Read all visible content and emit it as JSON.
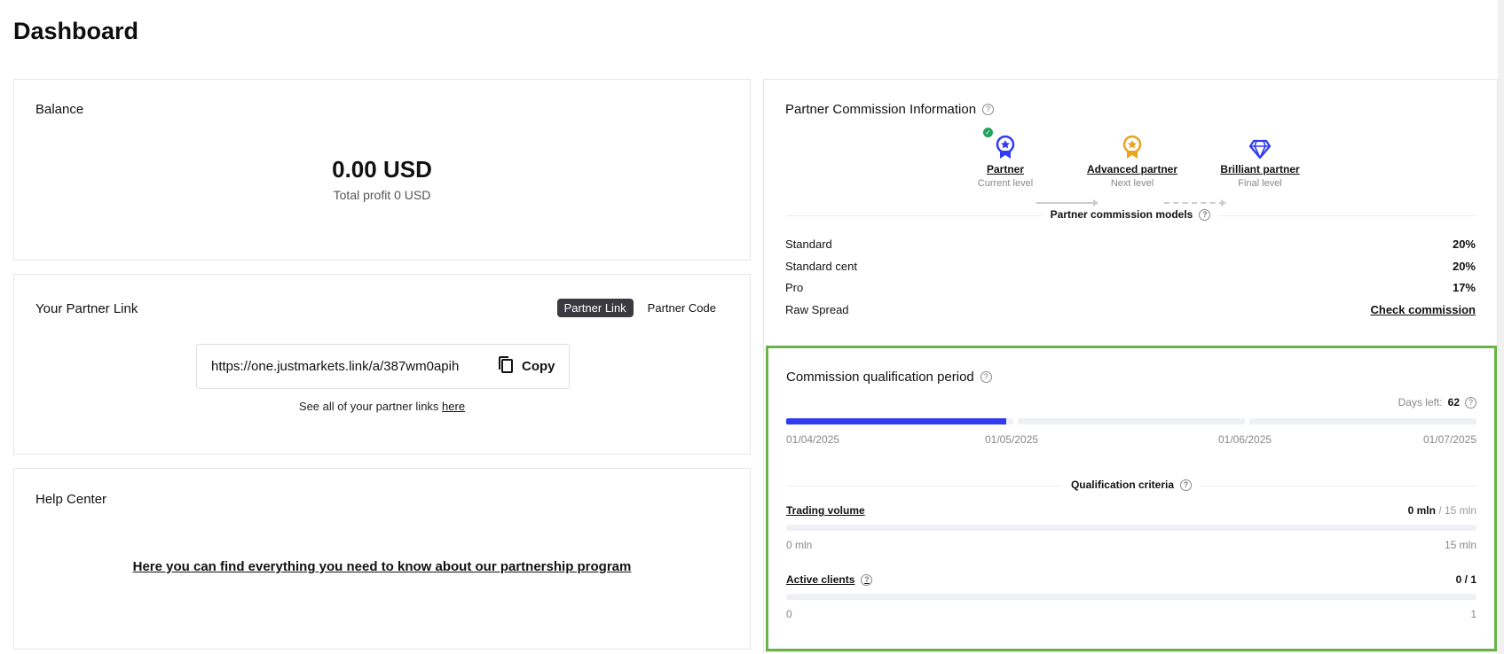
{
  "page": {
    "title": "Dashboard"
  },
  "balance": {
    "title": "Balance",
    "amount": "0.00 USD",
    "total_profit": "Total profit 0 USD"
  },
  "partner_link": {
    "title": "Your Partner Link",
    "toggles": [
      "Partner Link",
      "Partner Code"
    ],
    "active_toggle": "Partner Link",
    "url": "https://one.justmarkets.link/a/387wm0apih",
    "copy_label": "Copy",
    "note_prefix": "See all of your partner links ",
    "note_link": "here"
  },
  "help_center": {
    "title": "Help Center",
    "link_text": "Here you can find everything you need to know about our partnership program"
  },
  "commission_info": {
    "title": "Partner Commission Information",
    "levels": [
      {
        "name": "Partner",
        "sub": "Current level",
        "icon": "medal-blue-icon",
        "color": "#2e3bf0",
        "done": true
      },
      {
        "name": "Advanced partner",
        "sub": "Next level",
        "icon": "medal-gold-icon",
        "color": "#e8a320",
        "done": false
      },
      {
        "name": "Brilliant partner",
        "sub": "Final level",
        "icon": "diamond-icon",
        "color": "#2e3bf0",
        "done": false
      }
    ],
    "models_label": "Partner commission models",
    "models": [
      {
        "name": "Standard",
        "value": "20%"
      },
      {
        "name": "Standard cent",
        "value": "20%"
      },
      {
        "name": "Pro",
        "value": "17%"
      },
      {
        "name": "Raw Spread",
        "value": "Check commission"
      }
    ]
  },
  "qualification": {
    "title": "Commission qualification period",
    "days_left_label": "Days left:",
    "days_left": "62",
    "period_progress": [
      1.0,
      0.0,
      0.0
    ],
    "first_segment_progress": 0.97,
    "dates": [
      "01/04/2025",
      "01/05/2025",
      "01/06/2025",
      "01/07/2025"
    ],
    "criteria_label": "Qualification criteria",
    "criteria": [
      {
        "name": "Trading volume",
        "current": "0 mln",
        "total": "/ 15 mln",
        "min": "0 mln",
        "max": "15 mln",
        "progress": 0
      },
      {
        "name": "Active clients",
        "current": "0 / 1",
        "total": "",
        "min": "0",
        "max": "1",
        "progress": 0
      }
    ]
  }
}
